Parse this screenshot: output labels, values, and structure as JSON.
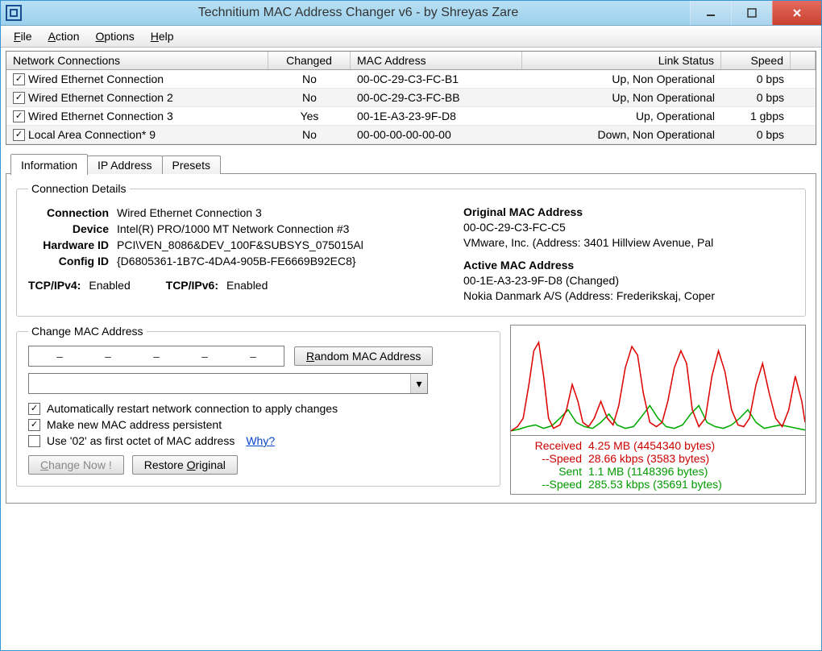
{
  "title": "Technitium MAC Address Changer v6 - by Shreyas Zare",
  "menu": {
    "file": "File",
    "action": "Action",
    "options": "Options",
    "help": "Help"
  },
  "grid": {
    "headers": {
      "name": "Network Connections",
      "changed": "Changed",
      "mac": "MAC Address",
      "link": "Link Status",
      "speed": "Speed"
    },
    "rows": [
      {
        "name": "Wired Ethernet Connection",
        "changed": "No",
        "mac": "00-0C-29-C3-FC-B1",
        "link": "Up, Non Operational",
        "speed": "0 bps"
      },
      {
        "name": "Wired Ethernet Connection 2",
        "changed": "No",
        "mac": "00-0C-29-C3-FC-BB",
        "link": "Up, Non Operational",
        "speed": "0 bps"
      },
      {
        "name": "Wired Ethernet Connection 3",
        "changed": "Yes",
        "mac": "00-1E-A3-23-9F-D8",
        "link": "Up, Operational",
        "speed": "1 gbps"
      },
      {
        "name": "Local Area Connection* 9",
        "changed": "No",
        "mac": "00-00-00-00-00-00",
        "link": "Down, Non Operational",
        "speed": "0 bps"
      }
    ]
  },
  "tabs": {
    "info": "Information",
    "ip": "IP Address",
    "presets": "Presets"
  },
  "details": {
    "legend": "Connection Details",
    "connection_k": "Connection",
    "connection_v": "Wired Ethernet Connection 3",
    "device_k": "Device",
    "device_v": "Intel(R) PRO/1000 MT Network Connection #3",
    "hwid_k": "Hardware ID",
    "hwid_v": "PCI\\VEN_8086&DEV_100F&SUBSYS_075015Al",
    "cfgid_k": "Config ID",
    "cfgid_v": "{D6805361-1B7C-4DA4-905B-FE6669B92EC8}",
    "ipv4_k": "TCP/IPv4:",
    "ipv4_v": "Enabled",
    "ipv6_k": "TCP/IPv6:",
    "ipv6_v": "Enabled",
    "orig_h": "Original MAC Address",
    "orig_mac": "00-0C-29-C3-FC-C5",
    "orig_vendor": "VMware, Inc.  (Address: 3401 Hillview Avenue, Pal",
    "active_h": "Active MAC Address",
    "active_mac": "00-1E-A3-23-9F-D8 (Changed)",
    "active_vendor": "Nokia Danmark A/S  (Address: Frederikskaj, Coper"
  },
  "change": {
    "legend": "Change MAC Address",
    "dash": "–",
    "random": "Random MAC Address",
    "auto_restart": "Automatically restart network connection to apply changes",
    "persistent": "Make new MAC address persistent",
    "octet": "Use '02' as first octet of MAC address",
    "why": "Why?",
    "change_now": "Change Now !",
    "restore": "Restore Original"
  },
  "stats": {
    "received_lbl": "Received",
    "received_val": "4.25 MB (4454340 bytes)",
    "rspeed_lbl": "--Speed",
    "rspeed_val": "28.66 kbps (3583 bytes)",
    "sent_lbl": "Sent",
    "sent_val": "1.1 MB (1148396 bytes)",
    "sspeed_lbl": "--Speed",
    "sspeed_val": "285.53 kbps (35691 bytes)"
  }
}
